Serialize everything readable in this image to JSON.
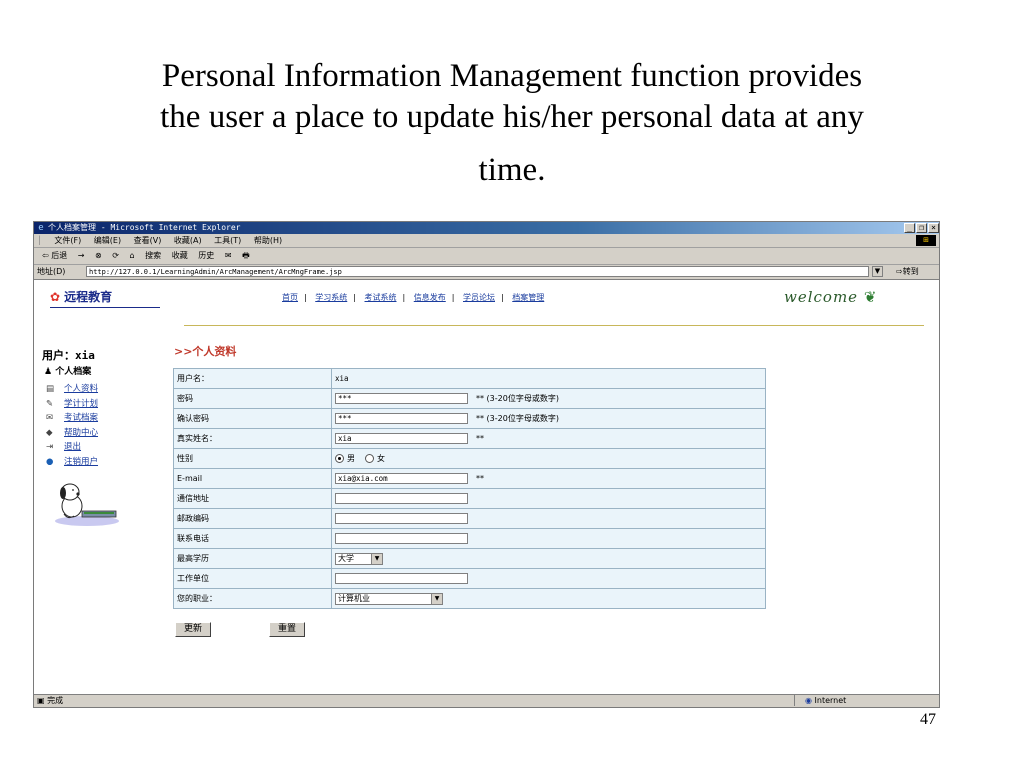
{
  "caption": {
    "line1": "Personal Information Management function provides",
    "line2": "the user a place to update his/her personal data at any",
    "line3": "time."
  },
  "slide_number": "47",
  "window": {
    "title": "个人档案管理 - Microsoft Internet Explorer",
    "controls": {
      "minimize": "_",
      "restore": "❐",
      "close": "×"
    },
    "menu": [
      "文件(F)",
      "编辑(E)",
      "查看(V)",
      "收藏(A)",
      "工具(T)",
      "帮助(H)"
    ],
    "toolbar": [
      "⇦ 后退",
      "→",
      "⊗",
      "⟳",
      "⌂",
      "搜索",
      "收藏",
      "历史",
      "✉",
      "🖶"
    ],
    "address_label": "地址(D)",
    "address_url": "http://127.0.0.1/LearningAdmin/ArcManagement/ArcMngFrame.jsp",
    "go_label": "转到",
    "status_text": "完成",
    "status_zone": "Internet"
  },
  "site": {
    "logo": "远程教育",
    "nav": [
      "首页",
      "学习系统",
      "考试系统",
      "信息发布",
      "学员论坛",
      "档案管理"
    ],
    "welcome": "welcome"
  },
  "sidebar": {
    "user_label": "用户：xia",
    "section": "个人档案",
    "items": [
      {
        "icon": "▤",
        "label": "个人资料"
      },
      {
        "icon": "✎",
        "label": "学计计划"
      },
      {
        "icon": "✉",
        "label": "考试档案"
      },
      {
        "icon": "◆",
        "label": "帮助中心"
      },
      {
        "icon": "⇥",
        "label": "退出"
      },
      {
        "icon": "●",
        "label": "注销用户"
      }
    ]
  },
  "form": {
    "title": ">>个人资料",
    "fields": {
      "username": {
        "label": "用户名：",
        "value": "xia"
      },
      "password": {
        "label": "密码",
        "value": "***",
        "hint": "** (3-20位字母或数字)"
      },
      "confirm": {
        "label": "确认密码",
        "value": "***",
        "hint": "** (3-20位字母或数字)"
      },
      "realname": {
        "label": "真实姓名：",
        "value": "xia",
        "hint": "**"
      },
      "gender": {
        "label": "性别",
        "male": "男",
        "female": "女"
      },
      "email": {
        "label": "E-mail",
        "value": "xia@xia.com",
        "hint": "**"
      },
      "address": {
        "label": "通信地址",
        "value": ""
      },
      "postcode": {
        "label": "邮政编码",
        "value": ""
      },
      "phone": {
        "label": "联系电话",
        "value": ""
      },
      "education": {
        "label": "最高学历",
        "value": "大学"
      },
      "workplace": {
        "label": "工作单位",
        "value": ""
      },
      "occupation": {
        "label": "您的职业：",
        "value": "计算机业"
      }
    },
    "buttons": {
      "update": "更新",
      "reset": "重置"
    }
  }
}
